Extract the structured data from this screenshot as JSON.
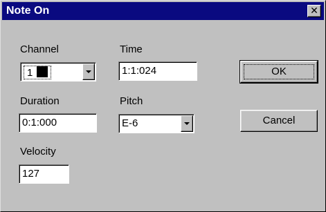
{
  "window": {
    "title": "Note On",
    "close_glyph": "✕"
  },
  "fields": {
    "channel": {
      "label": "Channel",
      "value": "1"
    },
    "time": {
      "label": "Time",
      "value": "1:1:024"
    },
    "duration": {
      "label": "Duration",
      "value": "0:1:000"
    },
    "pitch": {
      "label": "Pitch",
      "value": "E-6"
    },
    "velocity": {
      "label": "Velocity",
      "value": "127"
    }
  },
  "buttons": {
    "ok": "OK",
    "cancel": "Cancel"
  },
  "colors": {
    "title_bar": "#0a0a80",
    "dialog_face": "#c0c0c0",
    "channel_swatch": "#000000"
  }
}
